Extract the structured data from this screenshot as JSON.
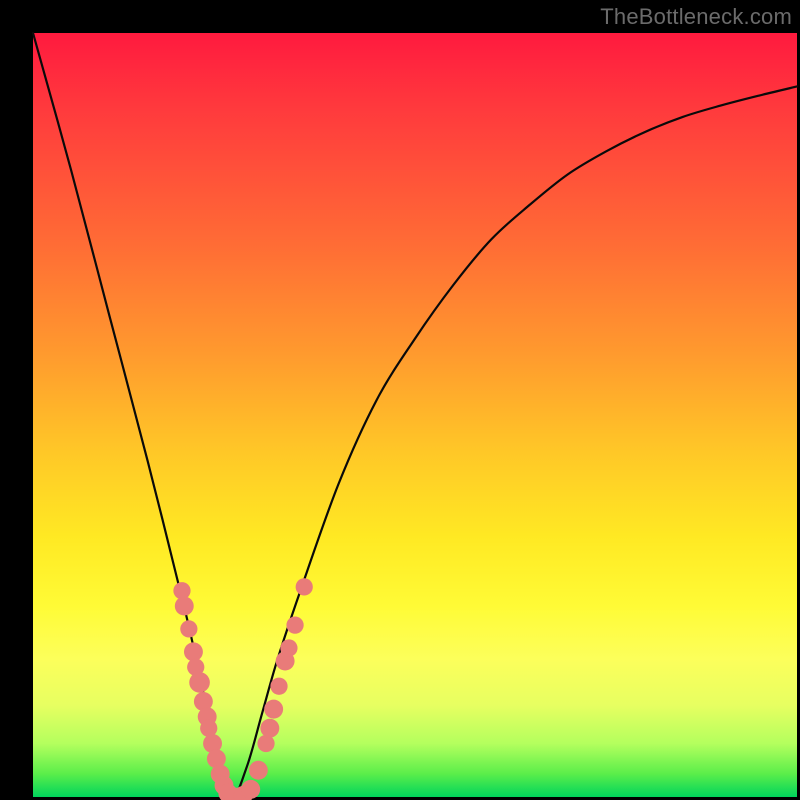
{
  "watermark": "TheBottleneck.com",
  "colors": {
    "curve_stroke": "#0a0a0a",
    "dot_fill": "#e97b79",
    "bg_black": "#000000"
  },
  "chart_data": {
    "type": "line",
    "title": "",
    "xlabel": "",
    "ylabel": "",
    "xlim": [
      0,
      100
    ],
    "ylim": [
      0,
      100
    ],
    "curve": {
      "description": "V-shaped bottleneck curve with minimum near x≈26",
      "x": [
        0,
        5,
        10,
        15,
        20,
        22,
        24,
        26,
        28,
        30,
        32,
        35,
        40,
        45,
        50,
        55,
        60,
        65,
        70,
        75,
        80,
        85,
        90,
        95,
        100
      ],
      "y": [
        100,
        82,
        63,
        44,
        24,
        15,
        6,
        0,
        4,
        11,
        18,
        27,
        41,
        52,
        60,
        67,
        73,
        77.5,
        81.5,
        84.5,
        87,
        89,
        90.5,
        91.8,
        93
      ]
    },
    "dots": {
      "description": "Highlighted data points clustered near the trough of the V",
      "points": [
        {
          "x": 19.5,
          "y": 27.0,
          "r": 1.1
        },
        {
          "x": 19.8,
          "y": 25.0,
          "r": 1.3
        },
        {
          "x": 20.4,
          "y": 22.0,
          "r": 1.1
        },
        {
          "x": 21.0,
          "y": 19.0,
          "r": 1.3
        },
        {
          "x": 21.3,
          "y": 17.0,
          "r": 1.1
        },
        {
          "x": 21.8,
          "y": 15.0,
          "r": 1.5
        },
        {
          "x": 22.3,
          "y": 12.5,
          "r": 1.3
        },
        {
          "x": 22.8,
          "y": 10.5,
          "r": 1.3
        },
        {
          "x": 23.0,
          "y": 9.0,
          "r": 1.1
        },
        {
          "x": 23.5,
          "y": 7.0,
          "r": 1.3
        },
        {
          "x": 24.0,
          "y": 5.0,
          "r": 1.3
        },
        {
          "x": 24.5,
          "y": 3.0,
          "r": 1.3
        },
        {
          "x": 25.0,
          "y": 1.5,
          "r": 1.3
        },
        {
          "x": 25.5,
          "y": 0.5,
          "r": 1.3
        },
        {
          "x": 26.3,
          "y": 0.0,
          "r": 1.3
        },
        {
          "x": 27.5,
          "y": 0.2,
          "r": 1.3
        },
        {
          "x": 28.5,
          "y": 1.0,
          "r": 1.3
        },
        {
          "x": 29.5,
          "y": 3.5,
          "r": 1.3
        },
        {
          "x": 30.5,
          "y": 7.0,
          "r": 1.1
        },
        {
          "x": 31.0,
          "y": 9.0,
          "r": 1.3
        },
        {
          "x": 31.5,
          "y": 11.5,
          "r": 1.3
        },
        {
          "x": 32.2,
          "y": 14.5,
          "r": 1.1
        },
        {
          "x": 33.0,
          "y": 17.8,
          "r": 1.3
        },
        {
          "x": 33.5,
          "y": 19.5,
          "r": 1.1
        },
        {
          "x": 34.3,
          "y": 22.5,
          "r": 1.1
        },
        {
          "x": 35.5,
          "y": 27.5,
          "r": 1.1
        }
      ]
    }
  }
}
